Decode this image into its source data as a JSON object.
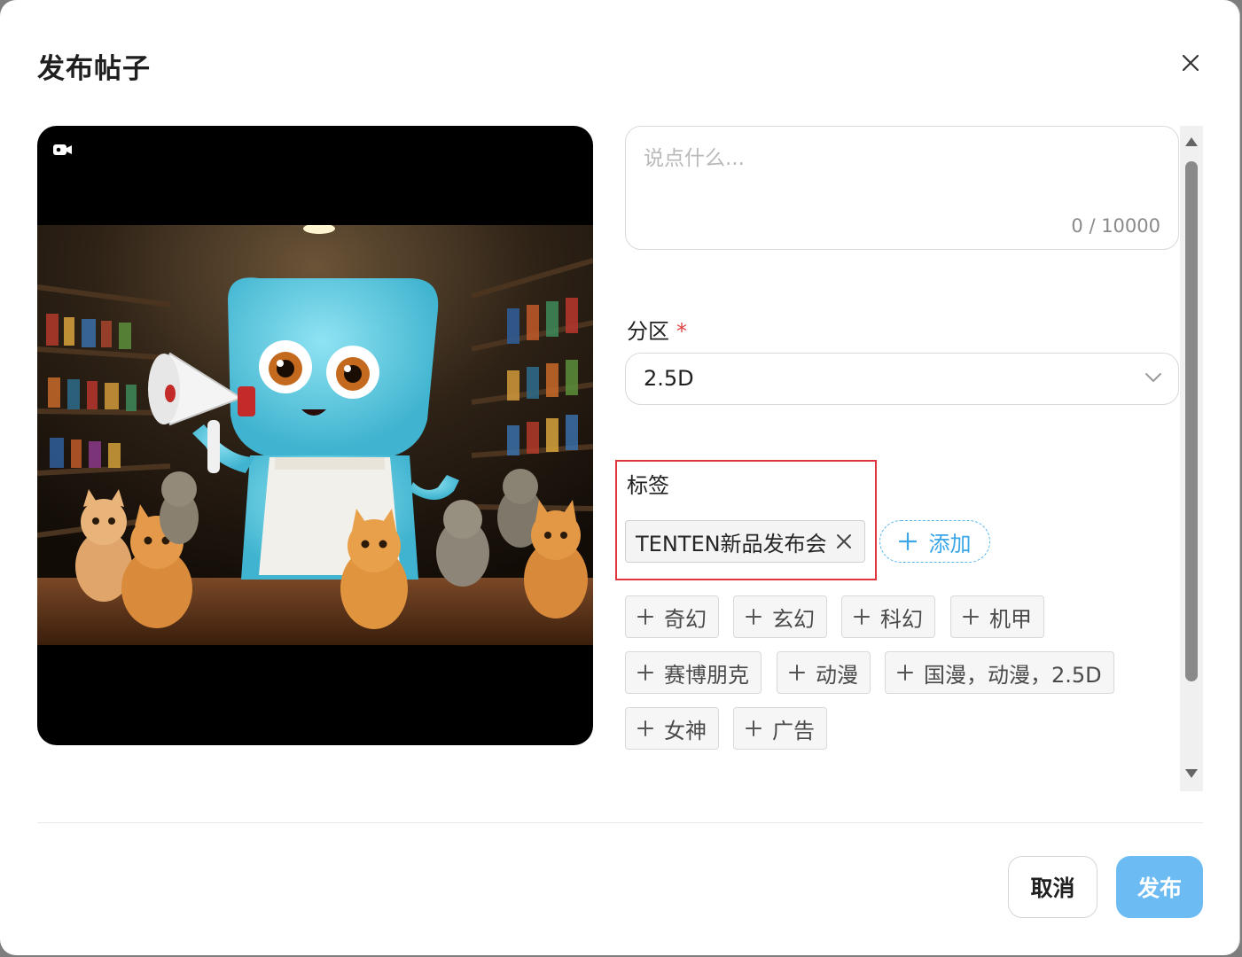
{
  "dialog": {
    "title": "发布帖子",
    "close_icon": "close-icon"
  },
  "media": {
    "type_icon": "video-camera-icon"
  },
  "content": {
    "placeholder": "说点什么...",
    "counter": "0 / 10000"
  },
  "section": {
    "label": "分区",
    "required_mark": "*",
    "selected": "2.5D",
    "icon": "chevron-down-icon"
  },
  "tags": {
    "label": "标签",
    "selected": [
      "TENTEN新品发布会"
    ],
    "add_label": "添加",
    "suggestions": [
      "奇幻",
      "玄幻",
      "科幻",
      "机甲",
      "赛博朋克",
      "动漫",
      "国漫，动漫，2.5D",
      "女神",
      "广告"
    ]
  },
  "footer": {
    "cancel_label": "取消",
    "publish_label": "发布"
  },
  "colors": {
    "accent": "#3aa6e8",
    "publish_button": "#6cbbf3",
    "highlight_box": "#e0353f",
    "required": "#e04545"
  }
}
